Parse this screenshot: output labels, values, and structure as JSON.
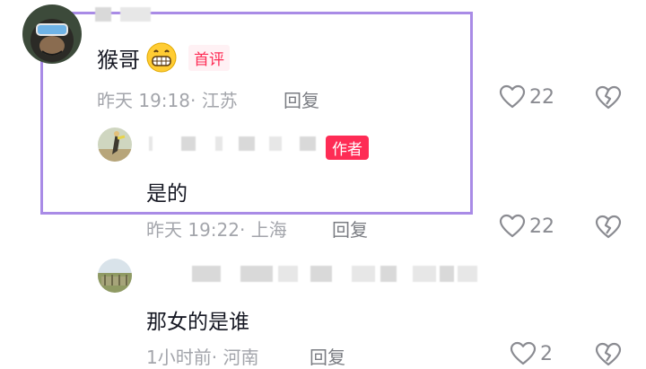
{
  "comments": [
    {
      "author": "猴哥",
      "emoji": "grinning-face-icon",
      "badge": "首评",
      "time": "昨天 19:18",
      "location": "江苏",
      "reply_label": "回复",
      "likes": "22"
    }
  ],
  "replies": [
    {
      "badge": "作者",
      "text": "是的",
      "time": "昨天 19:22",
      "location": "上海",
      "reply_label": "回复",
      "likes": "22"
    },
    {
      "text": "那女的是谁",
      "time": "1小时前",
      "location": "河南",
      "reply_label": "回复",
      "likes": "2"
    }
  ],
  "separator": "·",
  "colors": {
    "accent": "#fe2c55",
    "highlight_border": "#a98be6",
    "meta_text": "#a3a5ab"
  }
}
